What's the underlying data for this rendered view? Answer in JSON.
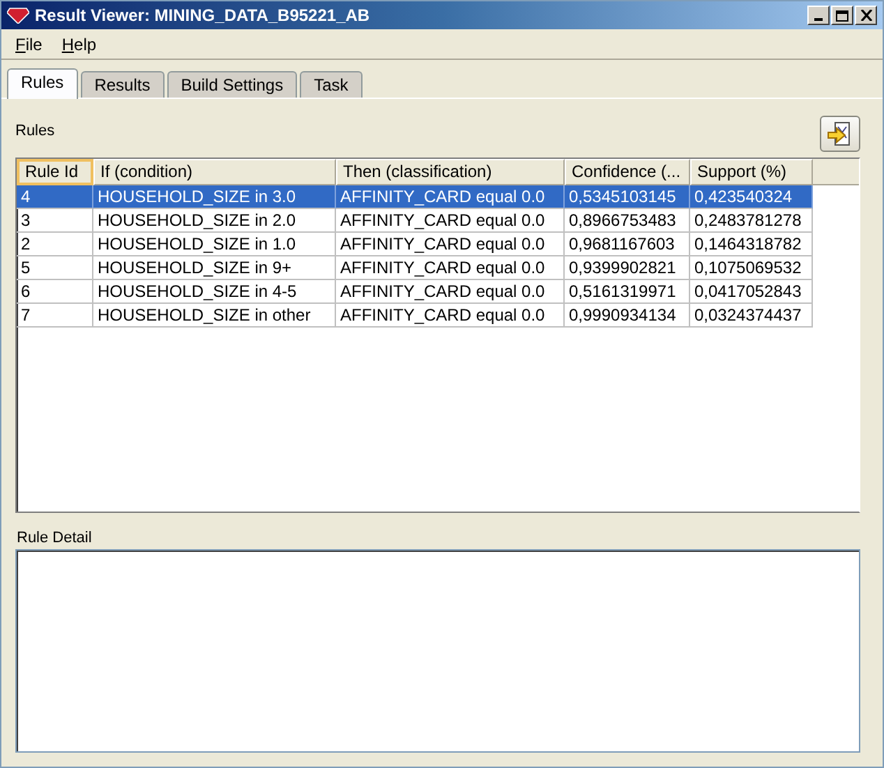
{
  "window": {
    "title": "Result Viewer: MINING_DATA_B95221_AB"
  },
  "menu": [
    "File",
    "Help"
  ],
  "tabs": [
    {
      "label": "Rules",
      "selected": true
    },
    {
      "label": "Results",
      "selected": false
    },
    {
      "label": "Build Settings",
      "selected": false
    },
    {
      "label": "Task",
      "selected": false
    }
  ],
  "rules_label": "Rules",
  "table": {
    "columns": [
      "Rule Id",
      "If (condition)",
      "Then (classification)",
      "Confidence (...",
      "Support (%)"
    ],
    "rows": [
      {
        "cells": [
          "4",
          "HOUSEHOLD_SIZE in 3.0",
          "AFFINITY_CARD equal 0.0",
          "0,5345103145",
          "0,423540324"
        ],
        "selected": true
      },
      {
        "cells": [
          "3",
          "HOUSEHOLD_SIZE in 2.0",
          "AFFINITY_CARD equal 0.0",
          "0,8966753483",
          "0,2483781278"
        ],
        "selected": false
      },
      {
        "cells": [
          "2",
          "HOUSEHOLD_SIZE in 1.0",
          "AFFINITY_CARD equal 0.0",
          "0,9681167603",
          "0,1464318782"
        ],
        "selected": false
      },
      {
        "cells": [
          "5",
          "HOUSEHOLD_SIZE in 9+",
          "AFFINITY_CARD equal 0.0",
          "0,9399902821",
          "0,1075069532"
        ],
        "selected": false
      },
      {
        "cells": [
          "6",
          "HOUSEHOLD_SIZE in 4-5",
          "AFFINITY_CARD equal 0.0",
          "0,5161319971",
          "0,0417052843"
        ],
        "selected": false
      },
      {
        "cells": [
          "7",
          "HOUSEHOLD_SIZE in other",
          "AFFINITY_CARD equal 0.0",
          "0,9990934134",
          "0,0324374437"
        ],
        "selected": false
      }
    ]
  },
  "rule_detail": {
    "label": "Rule Detail"
  }
}
